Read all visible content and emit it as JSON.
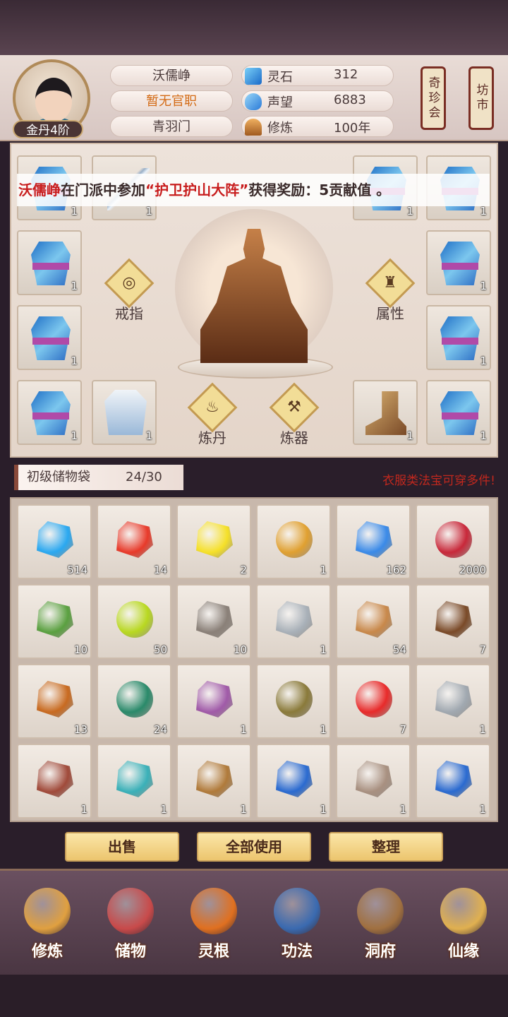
{
  "player": {
    "name": "沃儒峥",
    "official_rank": "暂无官职",
    "sect": "青羽门",
    "realm": "金丹4阶"
  },
  "resources": [
    {
      "icon": "spirit-stone-icon",
      "label": "灵石",
      "value": "312"
    },
    {
      "icon": "reputation-icon",
      "label": "声望",
      "value": "6883"
    },
    {
      "icon": "cultivation-icon",
      "label": "修炼",
      "value": "100年"
    }
  ],
  "side_signs": [
    "奇珍会",
    "坊市"
  ],
  "notice": {
    "name": "沃儒峥",
    "text1": "在门派中参加",
    "event": "“护卫护山大阵”",
    "text2": "获得奖励：5贡献值 。"
  },
  "equip_buttons": {
    "ring": "戒指",
    "attribute": "属性",
    "alchemy": "炼丹",
    "forging": "炼器"
  },
  "equip_slots": [
    {
      "icon": "robe-icon",
      "count": "1"
    },
    {
      "icon": "sword-icon",
      "count": "1"
    },
    {
      "icon": "robe-icon",
      "count": "1"
    },
    {
      "icon": "robe-icon",
      "count": "1"
    },
    {
      "icon": "robe-icon",
      "count": "1"
    },
    {
      "icon": "robe-icon",
      "count": "1"
    },
    {
      "icon": "robe-icon",
      "count": "1"
    },
    {
      "icon": "robe-icon",
      "count": "1"
    },
    {
      "icon": "robe-icon",
      "count": "1"
    },
    {
      "icon": "armor-icon",
      "count": "1"
    },
    {
      "icon": "boots-icon",
      "count": "1"
    },
    {
      "icon": "robe-icon",
      "count": "1"
    }
  ],
  "bag": {
    "title": "初级储物袋",
    "capacity": "24/30",
    "hint": "衣服类法宝可穿多件!"
  },
  "bag_items": [
    {
      "icon": "blue-crystal-icon",
      "count": "514",
      "color": "#2aa8f0"
    },
    {
      "icon": "red-crystal-icon",
      "count": "14",
      "color": "#e83a2a"
    },
    {
      "icon": "yellow-crystal-icon",
      "count": "2",
      "color": "#f5e028"
    },
    {
      "icon": "treasure-bag-icon",
      "count": "1",
      "color": "#e0a030"
    },
    {
      "icon": "blue-flame-icon",
      "count": "162",
      "color": "#3a8ae8"
    },
    {
      "icon": "meat-icon",
      "count": "2000",
      "color": "#c8283a"
    },
    {
      "icon": "herb-leaf-icon",
      "count": "10",
      "color": "#5aa040"
    },
    {
      "icon": "green-orb-icon",
      "count": "50",
      "color": "#b8d820"
    },
    {
      "icon": "ore-icon",
      "count": "10",
      "color": "#8a8078"
    },
    {
      "icon": "silver-stone-icon",
      "count": "1",
      "color": "#a8b0b8"
    },
    {
      "icon": "ginseng-icon",
      "count": "54",
      "color": "#c8884a"
    },
    {
      "icon": "root-icon",
      "count": "7",
      "color": "#7a4a28"
    },
    {
      "icon": "chili-icon",
      "count": "13",
      "color": "#c86a20"
    },
    {
      "icon": "gourd-icon",
      "count": "24",
      "color": "#2a8a6a"
    },
    {
      "icon": "scroll-icon",
      "count": "1",
      "color": "#a05aa8"
    },
    {
      "icon": "locked-bag-icon",
      "count": "1",
      "color": "#8a7a3a"
    },
    {
      "icon": "red-orb-icon",
      "count": "7",
      "color": "#e82a2a"
    },
    {
      "icon": "broadsword-icon",
      "count": "1",
      "color": "#a0a8b0"
    },
    {
      "icon": "bow-icon",
      "count": "1",
      "color": "#a04a3a"
    },
    {
      "icon": "cyan-robe-icon",
      "count": "1",
      "color": "#3ab0b8"
    },
    {
      "icon": "dagger-icon",
      "count": "1",
      "color": "#b07a3a"
    },
    {
      "icon": "robe-icon",
      "count": "1",
      "color": "#2a6ad0"
    },
    {
      "icon": "sword-icon",
      "count": "1",
      "color": "#a89080"
    },
    {
      "icon": "robe-icon",
      "count": "1",
      "color": "#2a6ad0"
    }
  ],
  "actions": [
    "出售",
    "全部使用",
    "整理"
  ],
  "nav": [
    {
      "icon": "cultivate-icon",
      "label": "修炼",
      "color": "#e0a040"
    },
    {
      "icon": "storage-icon",
      "label": "储物",
      "color": "#c84a4a"
    },
    {
      "icon": "spirit-root-icon",
      "label": "灵根",
      "color": "#e07020"
    },
    {
      "icon": "technique-icon",
      "label": "功法",
      "color": "#3a6ab0"
    },
    {
      "icon": "cave-icon",
      "label": "洞府",
      "color": "#a07040"
    },
    {
      "icon": "fortune-icon",
      "label": "仙缘",
      "color": "#e0b050"
    }
  ]
}
